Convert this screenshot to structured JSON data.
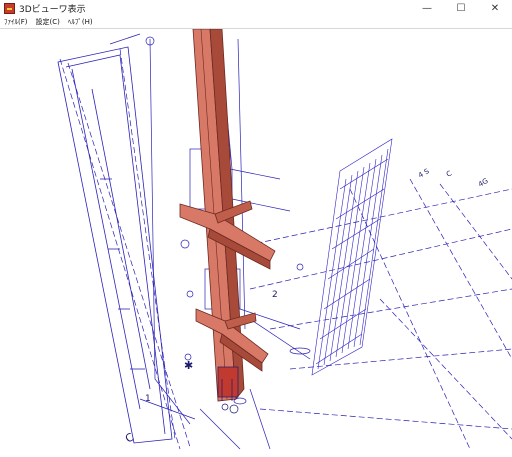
{
  "window": {
    "title": "3Dビューワ表示",
    "icon": "app-3d-icon",
    "controls": {
      "minimize": "—",
      "maximize": "☐",
      "close": "✕"
    }
  },
  "menu": [
    {
      "label": "ﾌｧｲﾙ(F)"
    },
    {
      "label": "設定(C)"
    },
    {
      "label": "ﾍﾙﾌﾟ(H)"
    }
  ],
  "viewport": {
    "labels": {
      "axis_c_top": "C",
      "axis_4s": "4 S",
      "axis_4g": "4G",
      "axis_c_bottom": "C",
      "num_1": "1",
      "num_2": "2",
      "star_mark": "✱"
    },
    "colors": {
      "line": "#2a22b8",
      "steel_fill": "#d87866",
      "steel_dark": "#a84a3a",
      "steel_edge": "#6b2a22"
    }
  }
}
